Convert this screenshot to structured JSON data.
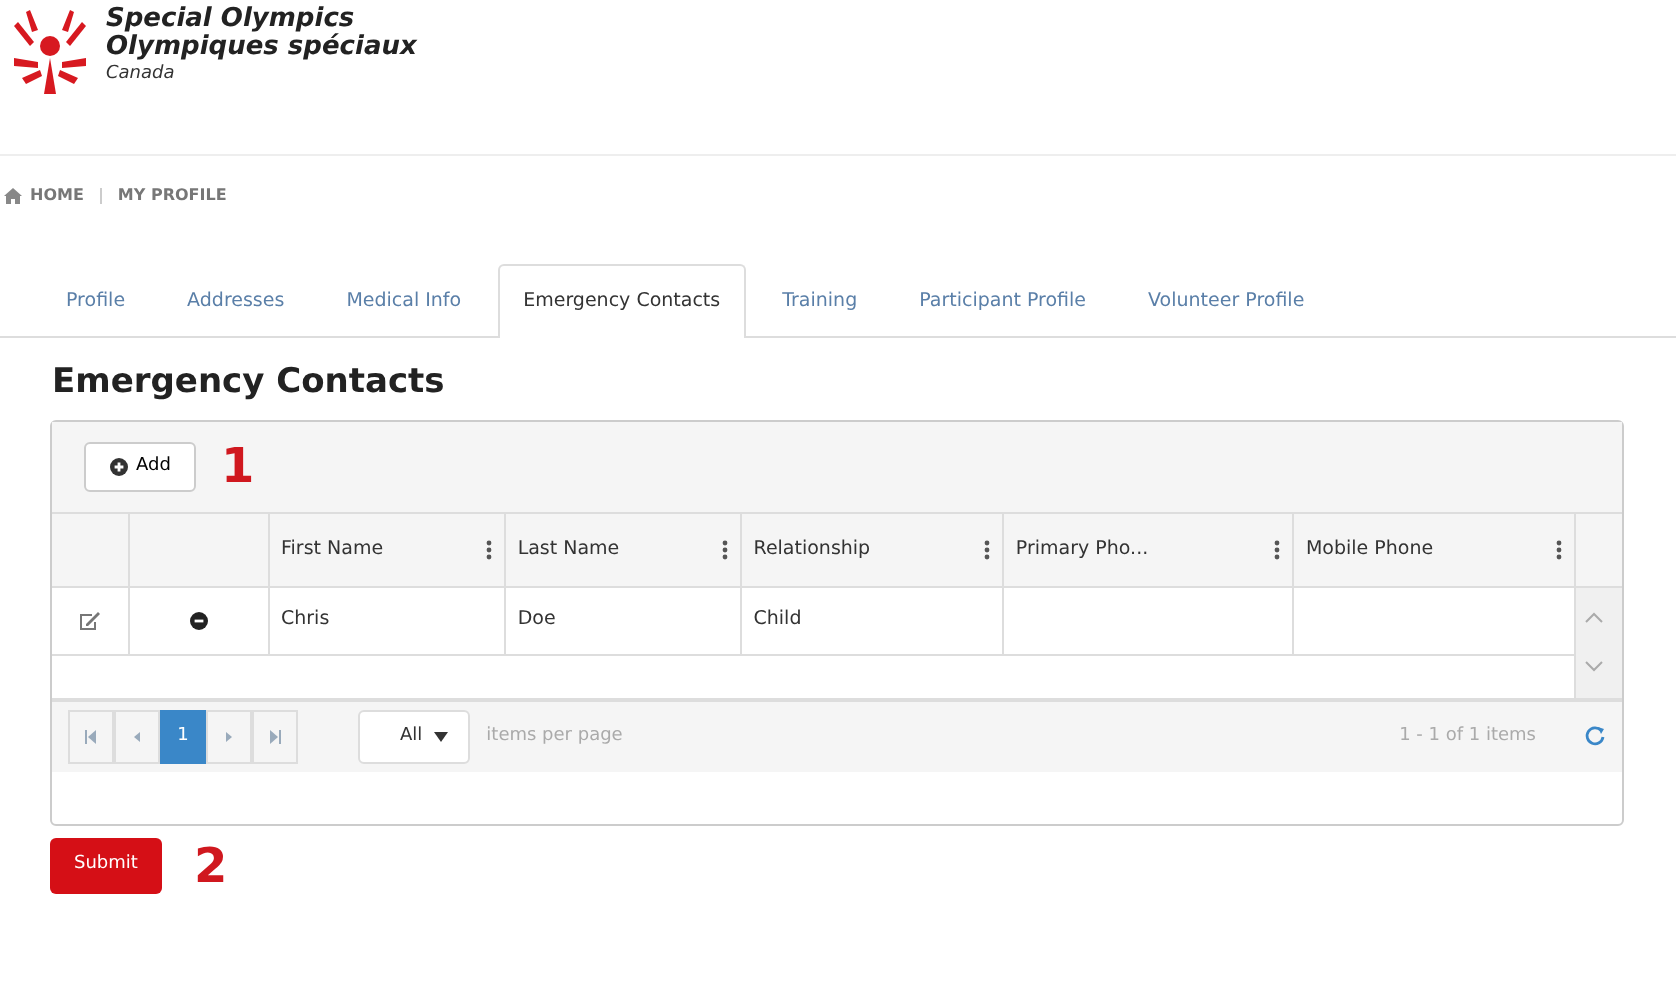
{
  "logo": {
    "line1": "Special Olympics",
    "line2": "Olympiques spéciaux",
    "line3": "Canada"
  },
  "breadcrumb": [
    "HOME",
    "MY PROFILE"
  ],
  "tabs": [
    {
      "label": "Profile",
      "selected": false
    },
    {
      "label": "Addresses",
      "selected": false
    },
    {
      "label": "Medical Info",
      "selected": false
    },
    {
      "label": "Emergency Contacts",
      "selected": true
    },
    {
      "label": "Training",
      "selected": false
    },
    {
      "label": "Participant Profile",
      "selected": false
    },
    {
      "label": "Volunteer Profile",
      "selected": false
    }
  ],
  "heading": "Emergency Contacts",
  "grid": {
    "add_button": "Add",
    "step_marker_1": "1",
    "columns": [
      "First Name",
      "Last Name",
      "Relationship",
      "Primary Pho...",
      "Mobile Phone"
    ],
    "rows": [
      [
        "Chris",
        "Doe",
        "Child",
        "",
        ""
      ]
    ],
    "pages": [
      {
        "label": "1",
        "selected": true
      }
    ],
    "page_size": "All",
    "page_size_label": "items per page",
    "summary": "1 - 1 of 1 items"
  },
  "submit_button": "Submit",
  "step_marker_2": "2"
}
